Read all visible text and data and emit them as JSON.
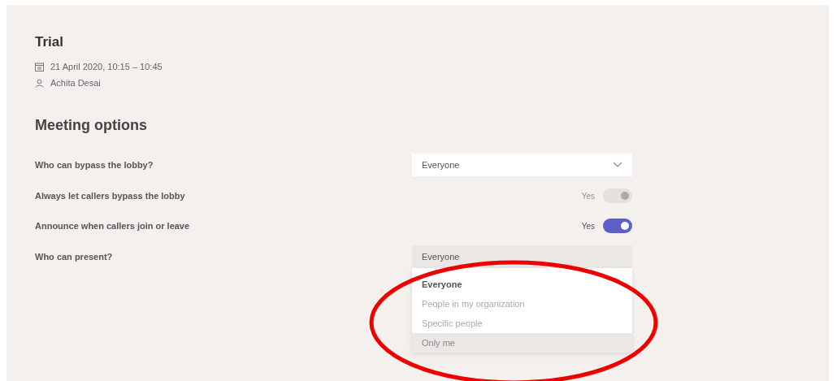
{
  "meeting": {
    "title": "Trial",
    "datetime": "21 April 2020, 10:15 – 10:45",
    "organizer": "Achita Desai"
  },
  "section_title": "Meeting options",
  "options": [
    {
      "kind": "dropdown",
      "label": "Who can bypass the lobby?",
      "value": "Everyone",
      "expanded": false
    },
    {
      "kind": "toggle",
      "label": "Always let callers bypass the lobby",
      "value": "Yes",
      "on": true,
      "disabled": true
    },
    {
      "kind": "toggle",
      "label": "Announce when callers join or leave",
      "value": "Yes",
      "on": true,
      "disabled": false
    },
    {
      "kind": "dropdown",
      "label": "Who can present?",
      "value": "Everyone",
      "expanded": true,
      "choices": [
        {
          "label": "Everyone",
          "selected": true,
          "highlighted": false
        },
        {
          "label": "People in my organization",
          "selected": false,
          "highlighted": false
        },
        {
          "label": "Specific people",
          "selected": false,
          "highlighted": false
        },
        {
          "label": "Only me",
          "selected": false,
          "highlighted": true
        }
      ]
    }
  ]
}
